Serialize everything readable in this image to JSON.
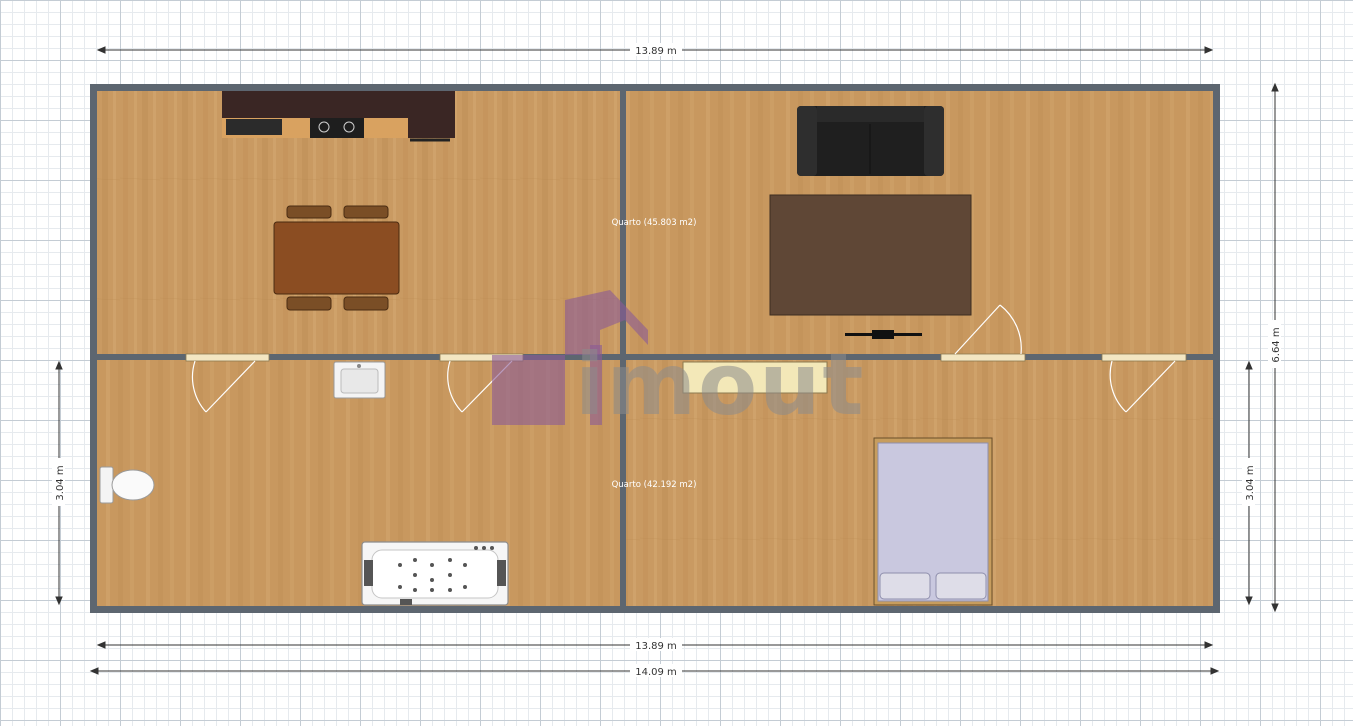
{
  "dimensions": {
    "top_width": "13.89 m",
    "bottom_inner_width": "13.89 m",
    "bottom_outer_width": "14.09 m",
    "right_height": "6.64 m",
    "left_lower_height": "3.04 m",
    "right_lower_height": "3.04 m"
  },
  "rooms": {
    "upper_label": "Quarto (45.803 m2)",
    "lower_label": "Quarto (42.192 m2)"
  },
  "watermark": {
    "text": "imout"
  },
  "colors": {
    "wall": "#5d6670",
    "floor": "#c99a62",
    "grid_major": "#c4ccd4",
    "grid_minor": "#e6eaee",
    "logo_purple": "#8a5a96"
  }
}
